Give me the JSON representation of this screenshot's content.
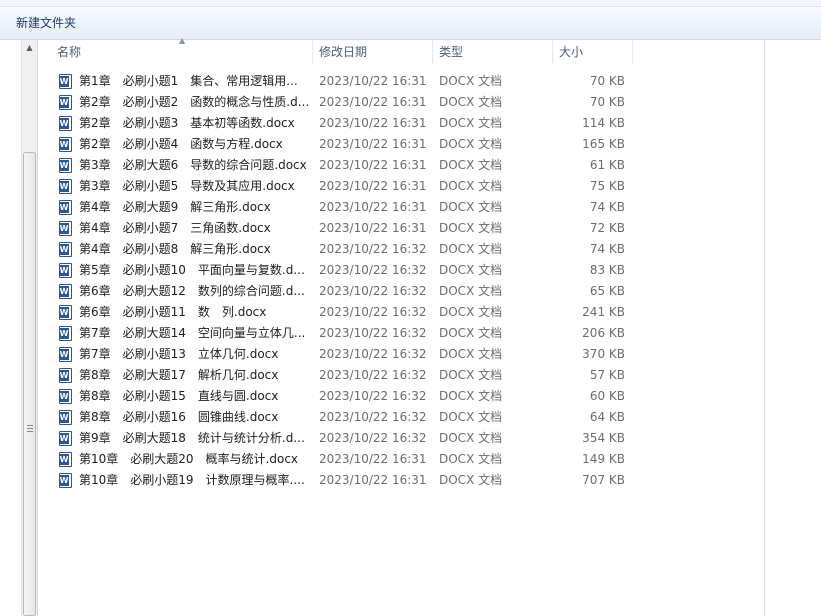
{
  "toolbar": {
    "new_folder": "新建文件夹"
  },
  "columns": {
    "name": "名称",
    "date": "修改日期",
    "type": "类型",
    "size": "大小"
  },
  "files": [
    {
      "name": "第1章　必刷小题1　集合、常用逻辑用...",
      "date": "2023/10/22 16:31",
      "type": "DOCX 文档",
      "size": "70 KB"
    },
    {
      "name": "第2章　必刷小题2　函数的概念与性质.d...",
      "date": "2023/10/22 16:31",
      "type": "DOCX 文档",
      "size": "70 KB"
    },
    {
      "name": "第2章　必刷小题3　基本初等函数.docx",
      "date": "2023/10/22 16:31",
      "type": "DOCX 文档",
      "size": "114 KB"
    },
    {
      "name": "第2章　必刷小题4　函数与方程.docx",
      "date": "2023/10/22 16:31",
      "type": "DOCX 文档",
      "size": "165 KB"
    },
    {
      "name": "第3章　必刷大题6　导数的综合问题.docx",
      "date": "2023/10/22 16:31",
      "type": "DOCX 文档",
      "size": "61 KB"
    },
    {
      "name": "第3章　必刷小题5　导数及其应用.docx",
      "date": "2023/10/22 16:31",
      "type": "DOCX 文档",
      "size": "75 KB"
    },
    {
      "name": "第4章　必刷大题9　解三角形.docx",
      "date": "2023/10/22 16:31",
      "type": "DOCX 文档",
      "size": "74 KB"
    },
    {
      "name": "第4章　必刷小题7　三角函数.docx",
      "date": "2023/10/22 16:31",
      "type": "DOCX 文档",
      "size": "72 KB"
    },
    {
      "name": "第4章　必刷小题8　解三角形.docx",
      "date": "2023/10/22 16:32",
      "type": "DOCX 文档",
      "size": "74 KB"
    },
    {
      "name": "第5章　必刷小题10　平面向量与复数.d...",
      "date": "2023/10/22 16:32",
      "type": "DOCX 文档",
      "size": "83 KB"
    },
    {
      "name": "第6章　必刷大题12　数列的综合问题.d...",
      "date": "2023/10/22 16:32",
      "type": "DOCX 文档",
      "size": "65 KB"
    },
    {
      "name": "第6章　必刷小题11　数　列.docx",
      "date": "2023/10/22 16:32",
      "type": "DOCX 文档",
      "size": "241 KB"
    },
    {
      "name": "第7章　必刷大题14　空间向量与立体几...",
      "date": "2023/10/22 16:32",
      "type": "DOCX 文档",
      "size": "206 KB"
    },
    {
      "name": "第7章　必刷小题13　立体几何.docx",
      "date": "2023/10/22 16:32",
      "type": "DOCX 文档",
      "size": "370 KB"
    },
    {
      "name": "第8章　必刷大题17　解析几何.docx",
      "date": "2023/10/22 16:32",
      "type": "DOCX 文档",
      "size": "57 KB"
    },
    {
      "name": "第8章　必刷小题15　直线与圆.docx",
      "date": "2023/10/22 16:32",
      "type": "DOCX 文档",
      "size": "60 KB"
    },
    {
      "name": "第8章　必刷小题16　圆锥曲线.docx",
      "date": "2023/10/22 16:32",
      "type": "DOCX 文档",
      "size": "64 KB"
    },
    {
      "name": "第9章　必刷大题18　统计与统计分析.d...",
      "date": "2023/10/22 16:32",
      "type": "DOCX 文档",
      "size": "354 KB"
    },
    {
      "name": "第10章　必刷大题20　概率与统计.docx",
      "date": "2023/10/22 16:31",
      "type": "DOCX 文档",
      "size": "149 KB"
    },
    {
      "name": "第10章　必刷小题19　计数原理与概率....",
      "date": "2023/10/22 16:31",
      "type": "DOCX 文档",
      "size": "707 KB"
    }
  ]
}
